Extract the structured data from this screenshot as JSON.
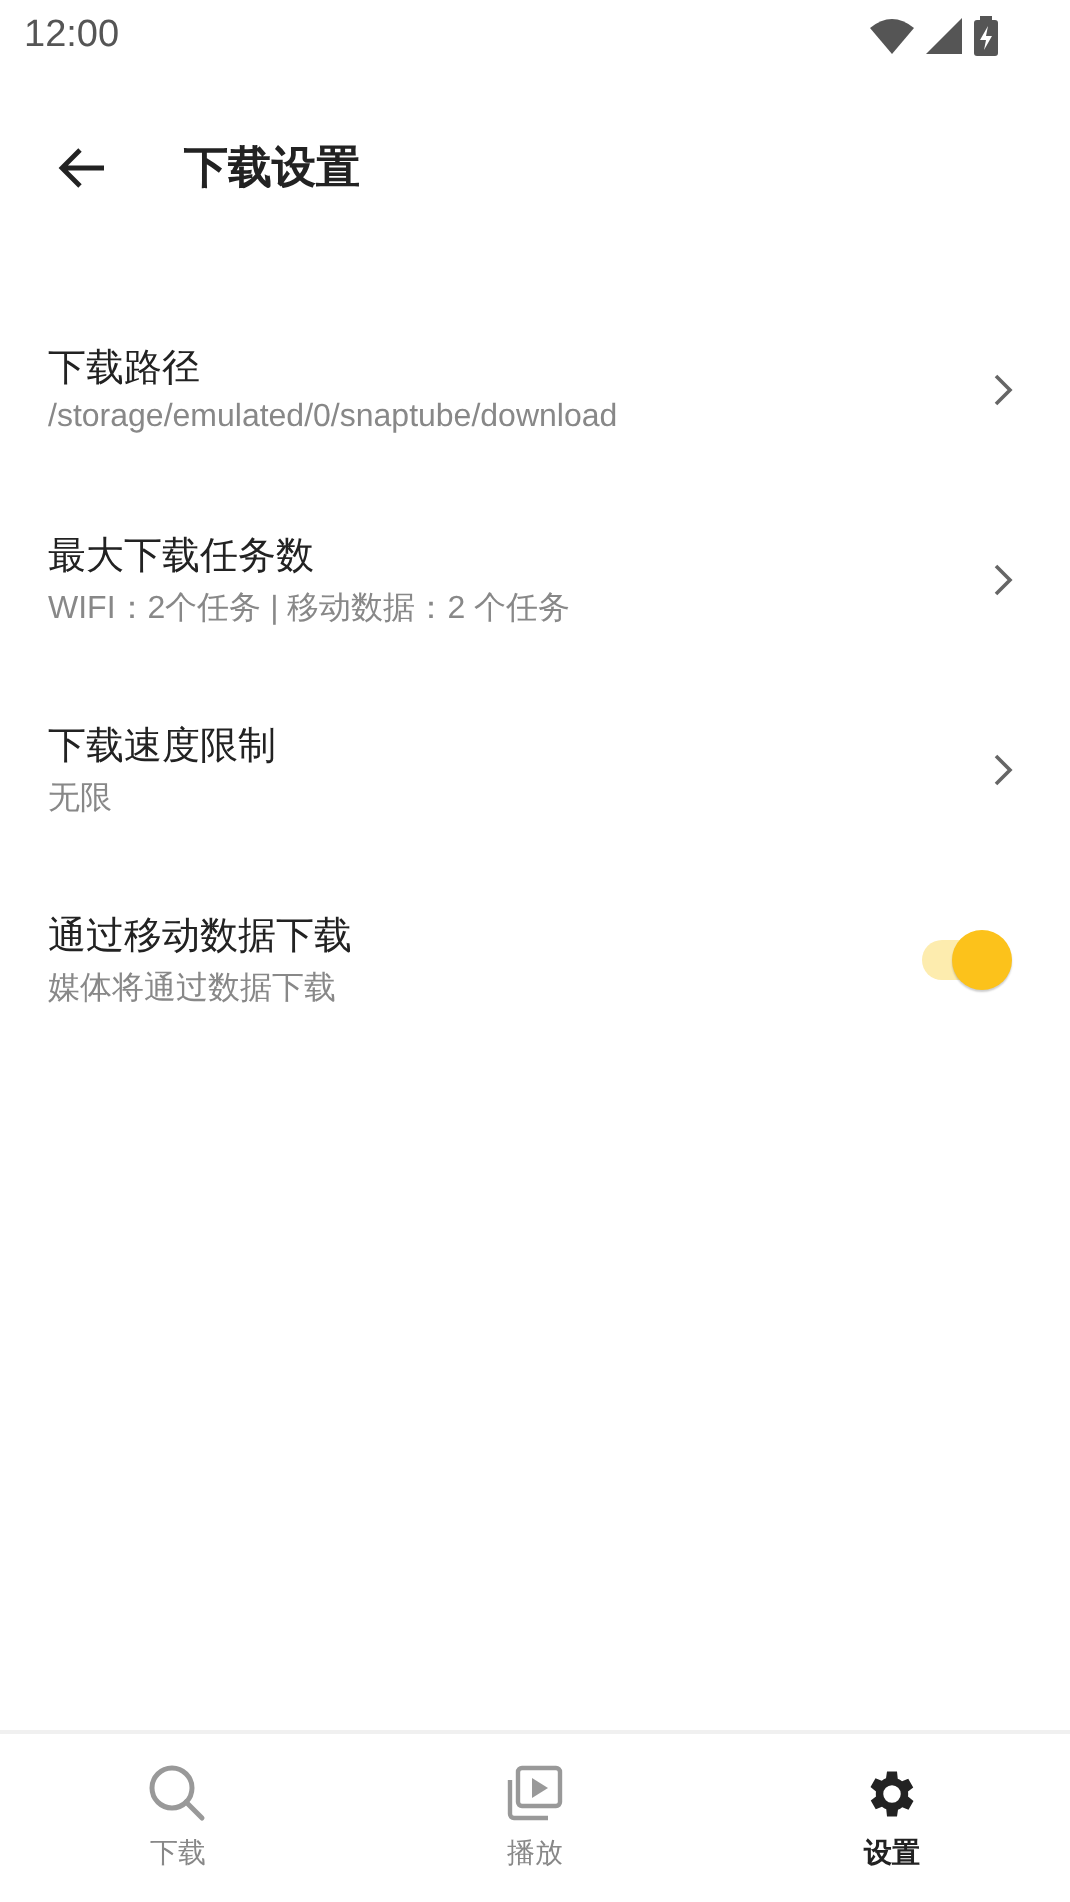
{
  "status_bar": {
    "time": "12:00"
  },
  "header": {
    "title": "下载设置"
  },
  "settings": [
    {
      "kind": "link",
      "title": "下载路径",
      "subtitle": "/storage/emulated/0/snaptube/download"
    },
    {
      "kind": "link",
      "title": "最大下载任务数",
      "subtitle": "WIFI：2个任务 | 移动数据：2 个任务"
    },
    {
      "kind": "link",
      "title": "下载速度限制",
      "subtitle": "无限"
    },
    {
      "kind": "toggle",
      "title": "通过移动数据下载",
      "subtitle": "媒体将通过数据下载",
      "on": true
    }
  ],
  "bottom_nav": [
    {
      "label": "下载",
      "selected": false
    },
    {
      "label": "播放",
      "selected": false
    },
    {
      "label": "设置",
      "selected": true
    }
  ]
}
